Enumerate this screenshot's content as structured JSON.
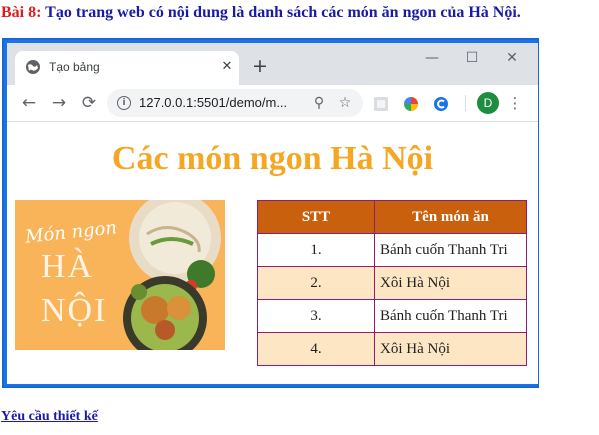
{
  "exercise": {
    "number_label": "Bài 8:",
    "description": "Tạo trang web có nội dung là danh sách các món ăn ngon của Hà Nội."
  },
  "browser": {
    "tab_title": "Tạo bảng",
    "tab_close": "✕",
    "new_tab": "+",
    "window_controls": {
      "minimize": "—",
      "maximize": "☐",
      "close": "✕"
    },
    "nav": {
      "back": "←",
      "forward": "→",
      "reload": "⟳"
    },
    "info_glyph": "i",
    "url": "127.0.0.1:5501/demo/m...",
    "zoom_glyph": "⚲",
    "star_glyph": "☆",
    "profile_initial": "D",
    "menu_glyph": "⋮"
  },
  "page": {
    "title": "Các món ngon Hà Nội",
    "image_text": {
      "script": "Món ngon",
      "line1": "HÀ",
      "line2": "NỘI"
    },
    "table": {
      "headers": [
        "STT",
        "Tên món ăn"
      ],
      "rows": [
        {
          "stt": "1.",
          "name": "Bánh cuốn Thanh Tri"
        },
        {
          "stt": "2.",
          "name": "Xôi Hà Nội"
        },
        {
          "stt": "3.",
          "name": "Bánh cuốn Thanh Tri"
        },
        {
          "stt": "4.",
          "name": "Xôi Hà Nội"
        }
      ]
    }
  },
  "footer_link": "Yêu cầu thiết kế",
  "colors": {
    "heading_blue": "#1a1aa6",
    "heading_red": "#e01b1b",
    "title_orange": "#f5a623",
    "table_header": "#c9600d",
    "table_border": "#8e1e74",
    "row_tint": "#fde6c4",
    "frame_blue": "#1a73e8"
  }
}
